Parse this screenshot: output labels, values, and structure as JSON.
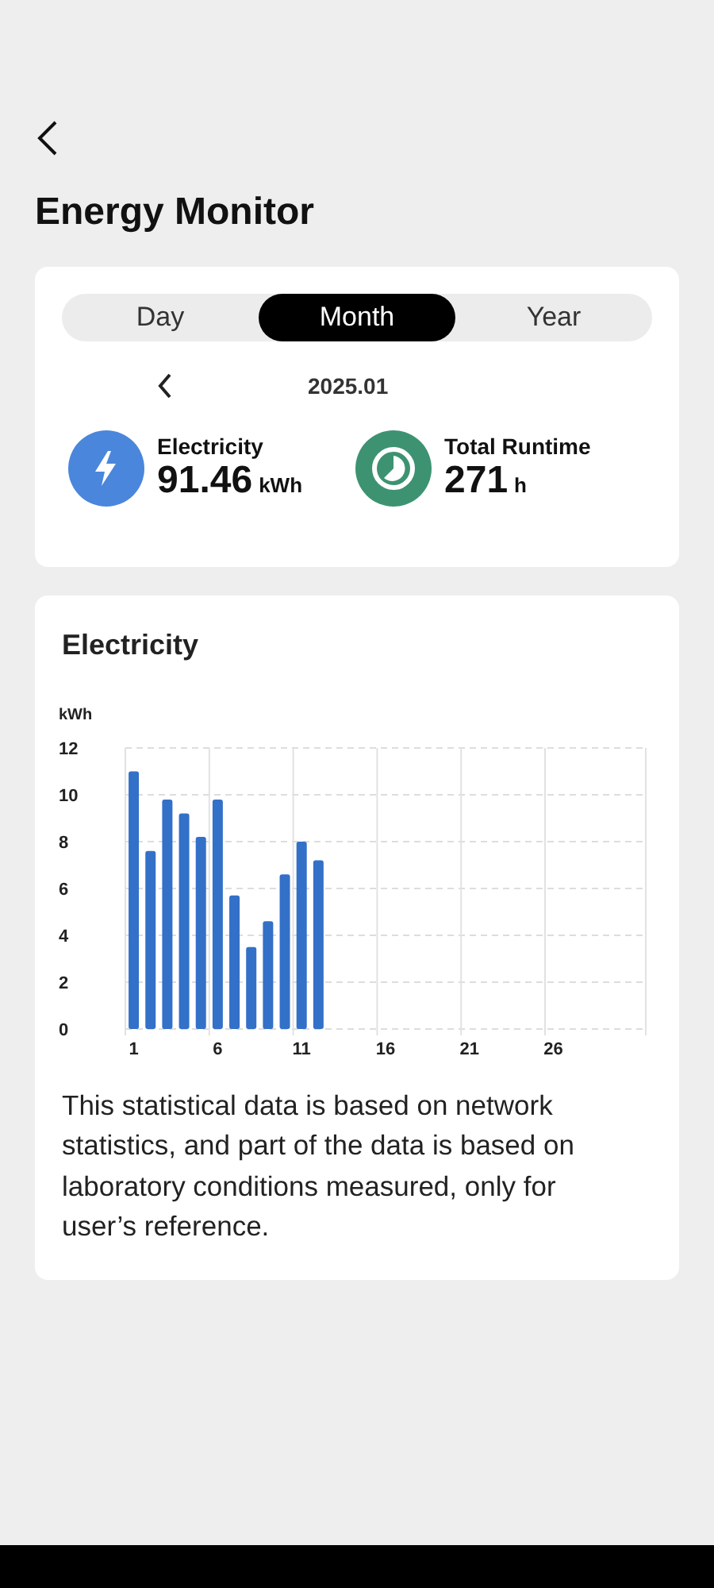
{
  "title": "Energy Monitor",
  "tabs": [
    {
      "label": "Day",
      "selected": false
    },
    {
      "label": "Month",
      "selected": true
    },
    {
      "label": "Year",
      "selected": false
    }
  ],
  "period": "2025.01",
  "stats": [
    {
      "kind": "electricity",
      "label": "Electricity",
      "value": "91.46",
      "unit": "kWh",
      "color": "#4a86dc"
    },
    {
      "kind": "runtime",
      "label": "Total Runtime",
      "value": "271",
      "unit": "h",
      "color": "#3d9371"
    }
  ],
  "chart_section": {
    "title": "Electricity",
    "chart_data": {
      "type": "bar",
      "ylabel": "kWh",
      "x": [
        1,
        2,
        3,
        4,
        5,
        6,
        7,
        8,
        9,
        10,
        11,
        12
      ],
      "series": [
        {
          "color": "#3370c8",
          "values": [
            11.0,
            7.6,
            9.8,
            9.2,
            8.2,
            9.8,
            5.7,
            3.5,
            4.6,
            6.6,
            8.0,
            7.2
          ]
        }
      ],
      "xlim": [
        0.5,
        31.5
      ],
      "ylim": [
        0,
        12
      ],
      "yticks": [
        0,
        2,
        4,
        6,
        8,
        10,
        12
      ],
      "xticks": [
        1,
        6,
        11,
        16,
        21,
        26
      ],
      "grid": true
    }
  },
  "note": "This statistical data is based on network statistics, and part of the data is based on laboratory conditions measured, only for user’s reference."
}
